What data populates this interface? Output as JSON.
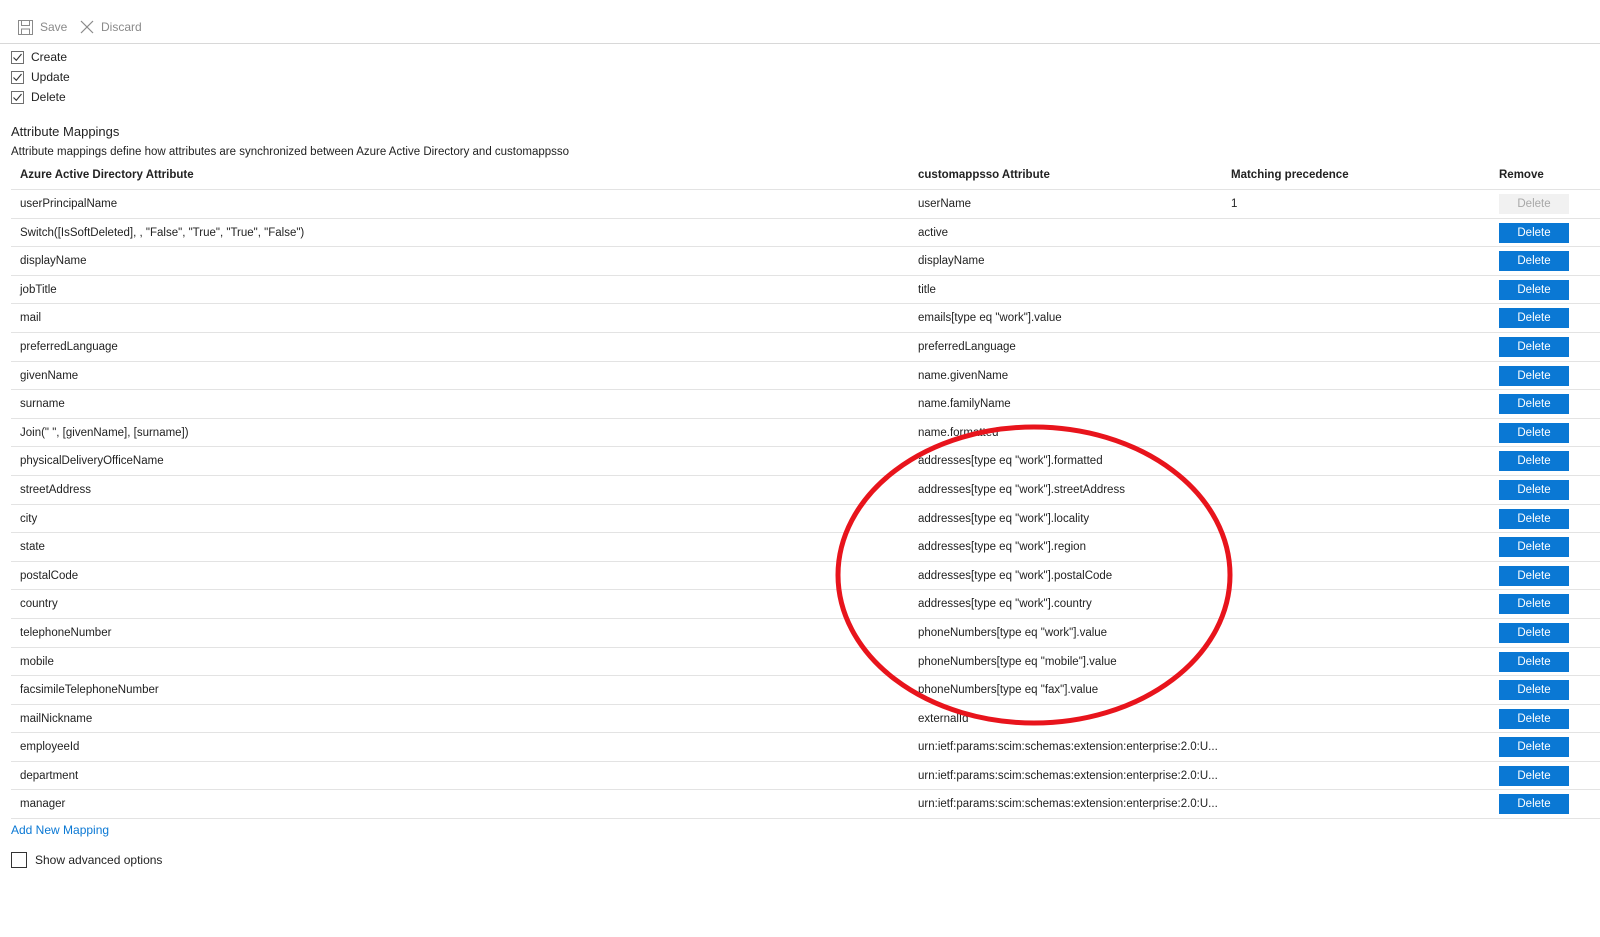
{
  "toolbar": {
    "save_label": "Save",
    "discard_label": "Discard"
  },
  "operations": [
    {
      "label": "Create",
      "checked": true
    },
    {
      "label": "Update",
      "checked": true
    },
    {
      "label": "Delete",
      "checked": true
    }
  ],
  "section": {
    "title": "Attribute Mappings",
    "description": "Attribute mappings define how attributes are synchronized between Azure Active Directory and customappsso"
  },
  "table": {
    "headers": {
      "source": "Azure Active Directory Attribute",
      "target": "customappsso Attribute",
      "precedence": "Matching precedence",
      "remove": "Remove"
    },
    "delete_label": "Delete",
    "rows": [
      {
        "source": "userPrincipalName",
        "target": "userName",
        "precedence": "1",
        "delete_disabled": true
      },
      {
        "source": "Switch([IsSoftDeleted], , \"False\", \"True\", \"True\", \"False\")",
        "target": "active",
        "precedence": ""
      },
      {
        "source": "displayName",
        "target": "displayName",
        "precedence": ""
      },
      {
        "source": "jobTitle",
        "target": "title",
        "precedence": ""
      },
      {
        "source": "mail",
        "target": "emails[type eq \"work\"].value",
        "precedence": ""
      },
      {
        "source": "preferredLanguage",
        "target": "preferredLanguage",
        "precedence": ""
      },
      {
        "source": "givenName",
        "target": "name.givenName",
        "precedence": ""
      },
      {
        "source": "surname",
        "target": "name.familyName",
        "precedence": ""
      },
      {
        "source": "Join(\" \", [givenName], [surname])",
        "target": "name.formatted",
        "precedence": ""
      },
      {
        "source": "physicalDeliveryOfficeName",
        "target": "addresses[type eq \"work\"].formatted",
        "precedence": ""
      },
      {
        "source": "streetAddress",
        "target": "addresses[type eq \"work\"].streetAddress",
        "precedence": ""
      },
      {
        "source": "city",
        "target": "addresses[type eq \"work\"].locality",
        "precedence": ""
      },
      {
        "source": "state",
        "target": "addresses[type eq \"work\"].region",
        "precedence": ""
      },
      {
        "source": "postalCode",
        "target": "addresses[type eq \"work\"].postalCode",
        "precedence": ""
      },
      {
        "source": "country",
        "target": "addresses[type eq \"work\"].country",
        "precedence": ""
      },
      {
        "source": "telephoneNumber",
        "target": "phoneNumbers[type eq \"work\"].value",
        "precedence": ""
      },
      {
        "source": "mobile",
        "target": "phoneNumbers[type eq \"mobile\"].value",
        "precedence": ""
      },
      {
        "source": "facsimileTelephoneNumber",
        "target": "phoneNumbers[type eq \"fax\"].value",
        "precedence": ""
      },
      {
        "source": "mailNickname",
        "target": "externalId",
        "precedence": ""
      },
      {
        "source": "employeeId",
        "target": "urn:ietf:params:scim:schemas:extension:enterprise:2.0:U...",
        "precedence": ""
      },
      {
        "source": "department",
        "target": "urn:ietf:params:scim:schemas:extension:enterprise:2.0:U...",
        "precedence": ""
      },
      {
        "source": "manager",
        "target": "urn:ietf:params:scim:schemas:extension:enterprise:2.0:U...",
        "precedence": ""
      }
    ]
  },
  "add_mapping_label": "Add New Mapping",
  "advanced": {
    "label": "Show advanced options",
    "checked": false
  },
  "colors": {
    "accent": "#0a78d4",
    "annotation": "#e8141c"
  },
  "icons": {
    "save": "save-icon",
    "discard": "close-icon",
    "check": "checkmark-icon"
  }
}
